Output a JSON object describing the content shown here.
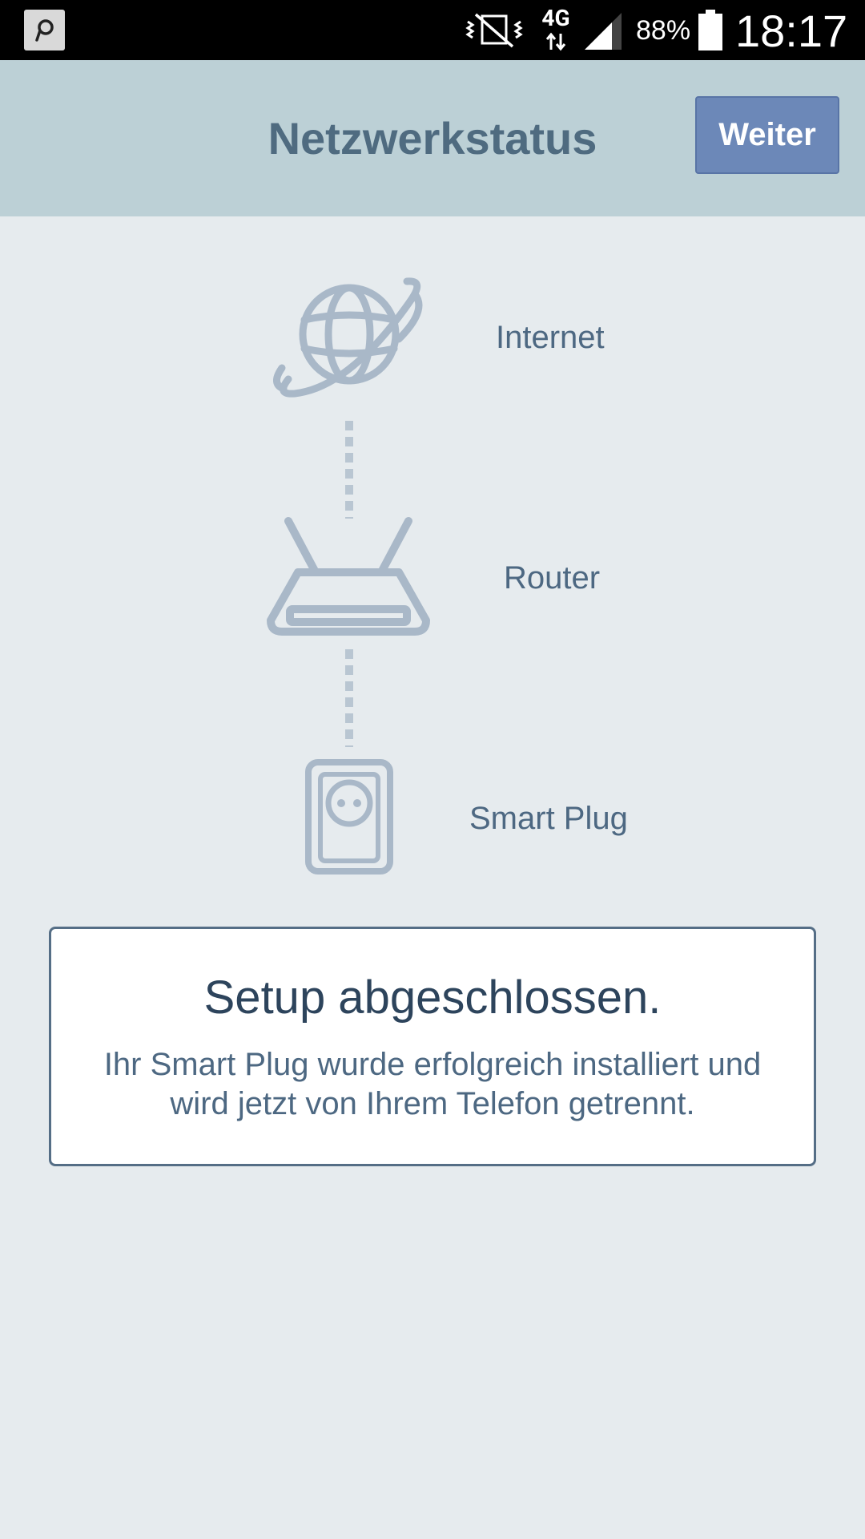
{
  "status_bar": {
    "app_icon": "pinterest-like-p-icon",
    "network_type": "4G",
    "battery_percent": "88%",
    "time": "18:17"
  },
  "header": {
    "title": "Netzwerkstatus",
    "next_label": "Weiter"
  },
  "network_chain": [
    {
      "label": "Internet",
      "icon": "globe-icon"
    },
    {
      "label": "Router",
      "icon": "router-icon"
    },
    {
      "label": "Smart Plug",
      "icon": "smart-plug-icon"
    }
  ],
  "result": {
    "title": "Setup abgeschlossen.",
    "message_line1": "Ihr Smart Plug wurde erfolgreich installiert und",
    "message_line2": "wird jetzt von Ihrem Telefon getrennt."
  },
  "colors": {
    "header_bg": "#bcd0d6",
    "page_bg": "#e6ebee",
    "button_bg": "#6c88b8",
    "icon": "#a9b8c8"
  }
}
